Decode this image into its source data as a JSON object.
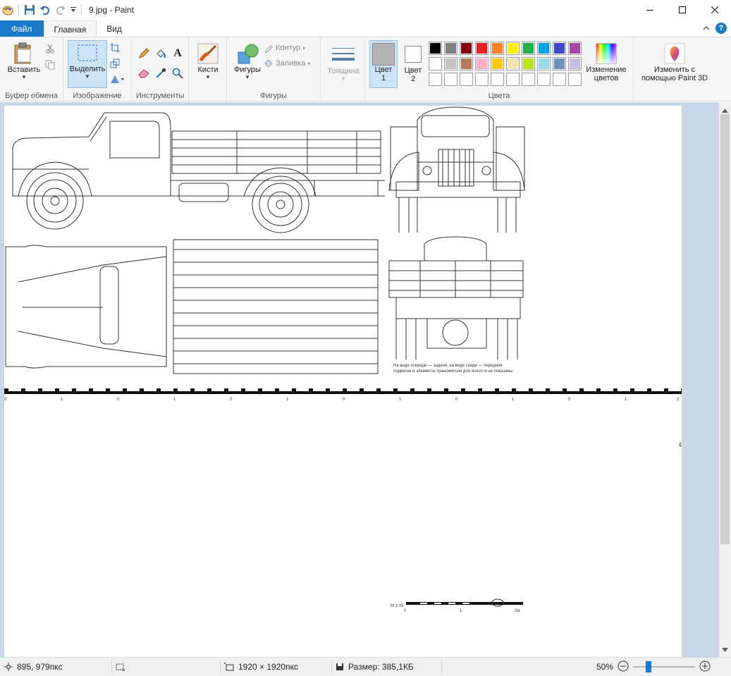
{
  "window": {
    "title": "9.jpg - Paint"
  },
  "tabs": [
    {
      "label": "Файл"
    },
    {
      "label": "Главная"
    },
    {
      "label": "Вид"
    }
  ],
  "ribbon": {
    "clipboard": {
      "paste_label": "Вставить",
      "group_label": "Буфер обмена"
    },
    "image": {
      "select_label": "Выделить",
      "group_label": "Изображение"
    },
    "tools": {
      "group_label": "Инструменты"
    },
    "brushes": {
      "label": "Кисти"
    },
    "shapes": {
      "shapes_label": "Фигуры",
      "outline_label": "Контур",
      "fill_label": "Заливка",
      "group_label": "Фигуры"
    },
    "size": {
      "label": "Толщина"
    },
    "colors": {
      "color1_label": "Цвет",
      "color1_num": "1",
      "color2_label": "Цвет",
      "color2_num": "2",
      "color1_value": "#b4b4b4",
      "color2_value": "#ffffff",
      "edit_colors_label_1": "Изменение",
      "edit_colors_label_2": "цветов",
      "group_label": "Цвета",
      "palette_row1": [
        "#000000",
        "#7f7f7f",
        "#880015",
        "#ed1c24",
        "#ff7f27",
        "#fff200",
        "#22b14c",
        "#00a2e8",
        "#3f48cc",
        "#a349a4"
      ],
      "palette_row2": [
        "#ffffff",
        "#c3c3c3",
        "#b97a57",
        "#ffaec9",
        "#ffc90e",
        "#efe4b0",
        "#b5e61d",
        "#99d9ea",
        "#7092be",
        "#c8bfe7"
      ]
    },
    "paint3d": {
      "label_1": "Изменить с",
      "label_2": "помощью Paint 3D"
    }
  },
  "canvas": {
    "caption_1": "На виде спереди — задняя, на виде сзади — передняя",
    "caption_2": "подвески и элементы трансмиссии для ясности не показаны",
    "ruler_ticks": [
      "0",
      "1",
      "0",
      "1",
      "0",
      "1",
      "0",
      "1",
      "0",
      "1",
      "0",
      "1",
      "2"
    ],
    "scale_label": "М 1:35",
    "scale_ticks": [
      "0",
      "1",
      "2м"
    ]
  },
  "status": {
    "cursor_pos": "895, 979пкс",
    "dimensions": "1920 × 1920пкс",
    "size": "Размер: 385,1КБ",
    "zoom": "50%",
    "zoom_level": 0.5
  }
}
